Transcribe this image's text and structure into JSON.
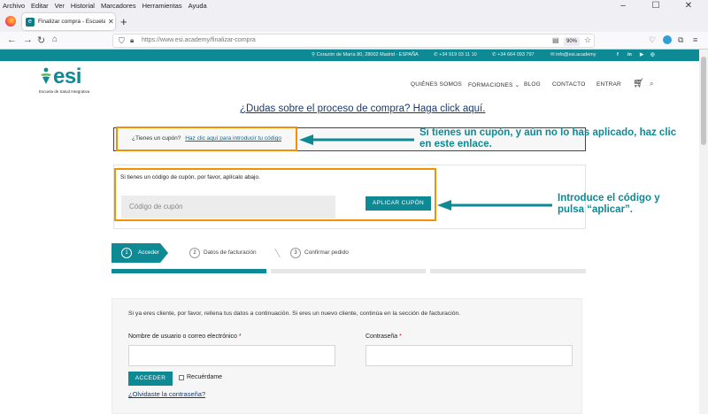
{
  "browser": {
    "menu": [
      "Archivo",
      "Editar",
      "Ver",
      "Historial",
      "Marcadores",
      "Herramientas",
      "Ayuda"
    ],
    "tab_title": "Finalizar compra - Escuela Salud",
    "url": "https://www.esi.academy/finalizar-compra",
    "zoom": "90%"
  },
  "topbar": {
    "address": "Corazón de María 80, 28002 Madrid - ESPAÑA",
    "phone1": "+34 919 03 11 10",
    "phone2": "+34 664 093 797",
    "email": "info@esi.academy",
    "social": [
      "f",
      "in",
      "▶",
      "◎"
    ]
  },
  "header": {
    "logo": "esi",
    "logo_sub": "Escuela de Salud Integrativa",
    "menu": [
      "QUIÉNES SOMOS",
      "FORMACIONES ⌄",
      "BLOG",
      "CONTACTO",
      "ENTRAR"
    ]
  },
  "help_link": "¿Dudas sobre el proceso de compra? Haga click aquí.",
  "coupon_notice": {
    "text": "¿Tienes un cupón?",
    "link": "Haz clic aquí para introducir tu código"
  },
  "coupon_box": {
    "text": "Si tienes un código de cupón, por favor, aplícalo abajo.",
    "placeholder": "Código de cupón",
    "button": "APLICAR CUPÓN"
  },
  "annotations": {
    "first": "Si tienes un cupón, y aún no lo has aplicado, haz clic en este enlace.",
    "second": "Introduce el código y pulsa “aplicar”."
  },
  "steps": [
    {
      "num": "1",
      "label": "Acceder"
    },
    {
      "num": "2",
      "label": "Datos de facturación"
    },
    {
      "num": "3",
      "label": "Confirmar pedido"
    }
  ],
  "login": {
    "intro": "Si ya eres cliente, por favor, rellena tus datos a continuación. Si eres un nuevo cliente, continúa en la sección de facturación.",
    "username_label": "Nombre de usuario o correo electrónico",
    "password_label": "Contraseña",
    "required_mark": "*",
    "button": "ACCEDER",
    "remember": "Recuérdame",
    "forgot": "¿Olvidaste la contraseña?"
  },
  "colors": {
    "brand": "#0e8a95",
    "highlight": "#f39200",
    "link": "#1a3a6e"
  }
}
